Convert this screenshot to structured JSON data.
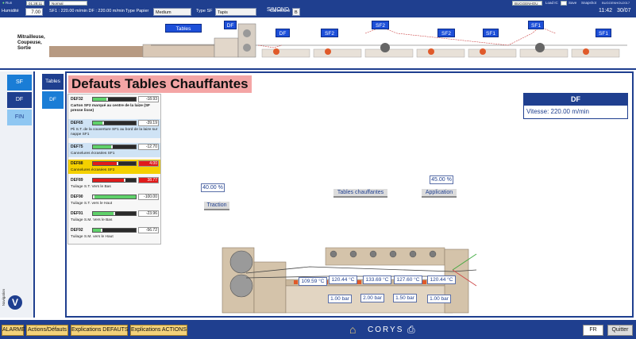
{
  "topbar": {
    "run_label": "Run",
    "clock": "01:28:11",
    "mode": "Normal",
    "user": "BUGGENHOU",
    "load_ic": "Load IC",
    "save": "Save",
    "snapshot": "Snapshot",
    "extra": "BUGGENHOU2017"
  },
  "toolbar": {
    "humidity_label": "Humidité",
    "humidity_value": "7.00",
    "info": "SF1 : 220.00 m/min DF : 220.00 m/min",
    "paper_type_label": "Type Papier",
    "paper_type_value": "Medium",
    "sf_type_label": "Type SF",
    "sf_type_value": "Tapis",
    "title": "SIMOND",
    "canneluro_label": "Cannelure",
    "canneluro_value": "B",
    "time": "11:42",
    "date": "30/07"
  },
  "process": {
    "left_title": [
      "Mitrailleuse,",
      "Coupeuse,",
      "Sortie"
    ],
    "buttons": [
      "Tables",
      "DF",
      "DF",
      "SF2",
      "SF2",
      "SF2",
      "SF1",
      "SF1",
      "SF1"
    ]
  },
  "nav": {
    "items": [
      "SF",
      "DF",
      "FIN"
    ],
    "vertical": "Navigation",
    "logo": "V"
  },
  "tabs": {
    "tables": "Tables",
    "df": "DF"
  },
  "page_title": "Defauts Tables Chauffantes",
  "defects": [
    {
      "code": "DEF32",
      "value": "-18.93",
      "desc": "Carton SF2 marqué au centre de la laize (SF presse lisse)",
      "level": 0.32,
      "alarm": false
    },
    {
      "code": "DEF65",
      "value": "-39.19",
      "desc": "Pli S.T. de la couverture SF1 au bord de la laize sur nappe SF1",
      "level": 0.22,
      "alarm": false
    },
    {
      "code": "DEF75",
      "value": "-12.70",
      "desc": "Cannelures écrasées SF1",
      "level": 0.42,
      "alarm": false
    },
    {
      "code": "DEF88",
      "value": "4.00",
      "desc": "Cannelures écrasées SF2",
      "level": 0.55,
      "alarm": true
    },
    {
      "code": "DEF89",
      "value": "38.77",
      "desc": "Tuilage S.T. Vers le Bas",
      "level": 0.72,
      "alarm": true
    },
    {
      "code": "DEF90",
      "value": "-100.00",
      "desc": "Tuilage S.T. vers le Haut",
      "level": 0.0,
      "alarm": false
    },
    {
      "code": "DEF91",
      "value": "-23.96",
      "desc": "Tuilage S.M. Vers le Bas",
      "level": 0.48,
      "alarm": false
    },
    {
      "code": "DEF92",
      "value": "-56.72",
      "desc": "Tuilage S.M. vers le Haut",
      "level": 0.18,
      "alarm": false
    }
  ],
  "df_panel": {
    "title": "DF",
    "speed": "Vitesse: 220.00 m/min"
  },
  "controls": {
    "traction_value": "40.00 %",
    "traction_label": "Traction",
    "tables_label": "Tables chauffantes",
    "application_value": "45.00 %",
    "application_label": "Application"
  },
  "temps": [
    "109.59 °C",
    "120.44 °C",
    "133.69 °C",
    "127.60 °C",
    "120.44 °C"
  ],
  "pressures": [
    "1.00 bar",
    "2.00 bar",
    "1.50 bar",
    "1.00 bar"
  ],
  "bottom": {
    "alarme": "ALARME",
    "actions_defauts": "Actions/Défauts",
    "explications_defauts": "Explications DEFAUTS",
    "explications_actions": "Explications ACTIONS",
    "brand": "CORYS",
    "lang": "FR",
    "quit": "Quitter"
  },
  "colors": {
    "navy": "#1f3f8f",
    "button_blue": "#1d4fd8",
    "title_bg": "#f4a5a5",
    "alarm_red": "#e01b1b",
    "highlight_blue": "#cfe3f5",
    "highlight_yellow": "#f4d000",
    "bar_green": "#5fd16a"
  }
}
